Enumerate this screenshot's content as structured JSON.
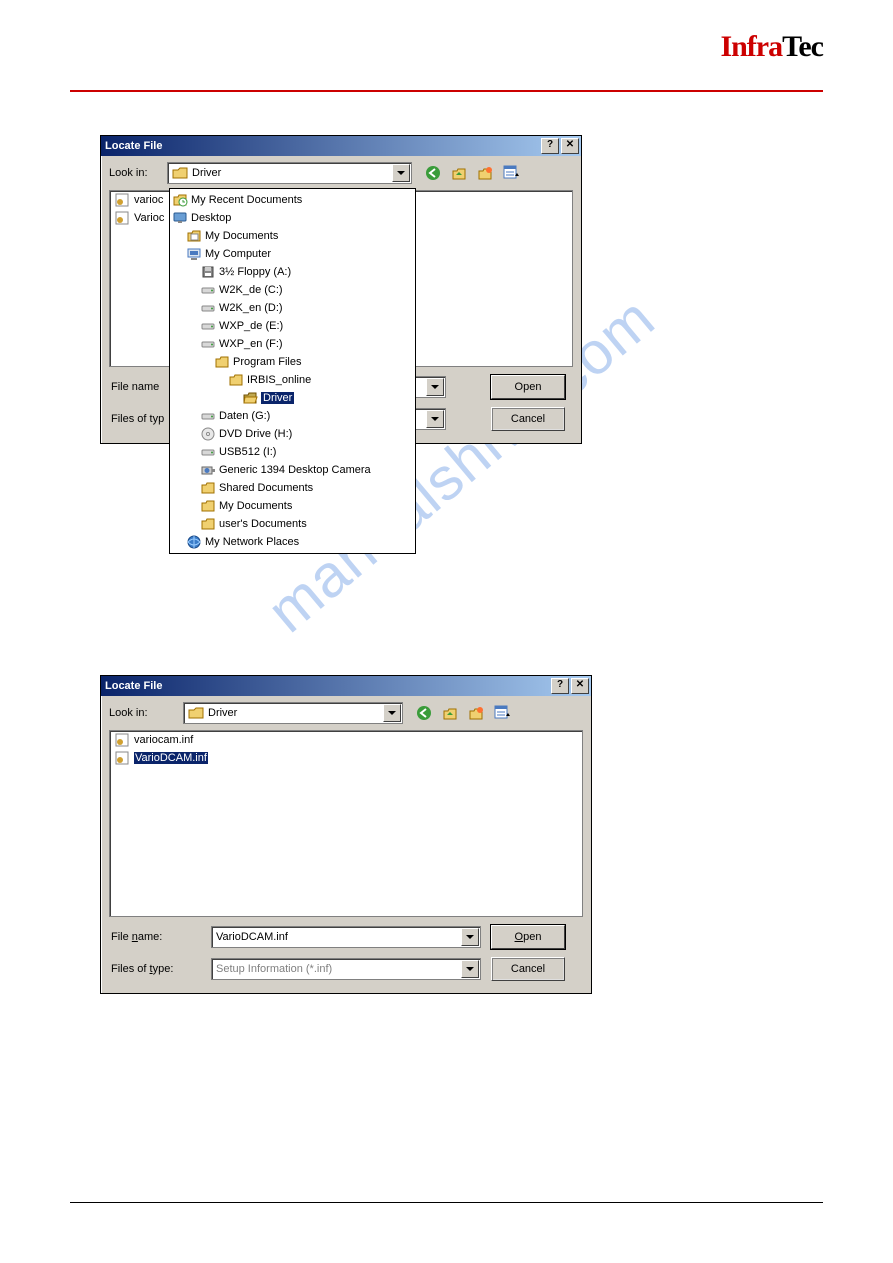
{
  "document": {
    "logo_red": "Infra",
    "logo_black": "Tec",
    "watermark": "manualshive.com"
  },
  "dialog1": {
    "title": "Locate File",
    "look_in_label": "Look in:",
    "look_in_value": "Driver",
    "file_items_behind": [
      "varioc",
      "Varioc"
    ],
    "tree": [
      {
        "indent": 0,
        "icon": "recent",
        "label": "My Recent Documents"
      },
      {
        "indent": 0,
        "icon": "desktop",
        "label": "Desktop"
      },
      {
        "indent": 1,
        "icon": "mydocs",
        "label": "My Documents"
      },
      {
        "indent": 1,
        "icon": "computer",
        "label": "My Computer"
      },
      {
        "indent": 2,
        "icon": "floppy",
        "label": "3½ Floppy (A:)"
      },
      {
        "indent": 2,
        "icon": "drive",
        "label": "W2K_de (C:)"
      },
      {
        "indent": 2,
        "icon": "drive",
        "label": "W2K_en (D:)"
      },
      {
        "indent": 2,
        "icon": "drive",
        "label": "WXP_de (E:)"
      },
      {
        "indent": 2,
        "icon": "drive",
        "label": "WXP_en (F:)"
      },
      {
        "indent": 3,
        "icon": "folder",
        "label": "Program Files"
      },
      {
        "indent": 4,
        "icon": "folder",
        "label": "IRBIS_online"
      },
      {
        "indent": 5,
        "icon": "folder-open",
        "label": "Driver",
        "selected": true
      },
      {
        "indent": 2,
        "icon": "drive",
        "label": "Daten (G:)"
      },
      {
        "indent": 2,
        "icon": "cd",
        "label": "DVD Drive (H:)"
      },
      {
        "indent": 2,
        "icon": "drive",
        "label": "USB512 (I:)"
      },
      {
        "indent": 2,
        "icon": "camera",
        "label": "Generic 1394 Desktop Camera"
      },
      {
        "indent": 2,
        "icon": "folder",
        "label": "Shared Documents"
      },
      {
        "indent": 2,
        "icon": "folder",
        "label": "My Documents"
      },
      {
        "indent": 2,
        "icon": "folder",
        "label": "user's Documents"
      },
      {
        "indent": 1,
        "icon": "network",
        "label": "My Network Places"
      }
    ],
    "file_name_label": "File name",
    "files_type_label": "Files of typ",
    "open_btn": "Open",
    "cancel_btn": "Cancel"
  },
  "dialog2": {
    "title": "Locate File",
    "look_in_label": "Look in:",
    "look_in_value": "Driver",
    "files": [
      {
        "name": "variocam.inf",
        "selected": false
      },
      {
        "name": "VarioDCAM.inf",
        "selected": true
      }
    ],
    "file_name_label": "File name:",
    "file_name_value": "VarioDCAM.inf",
    "files_type_label": "Files of type:",
    "files_type_value": "Setup Information (*.inf)",
    "open_btn": "Open",
    "open_hotkey": "O",
    "cancel_btn": "Cancel"
  }
}
